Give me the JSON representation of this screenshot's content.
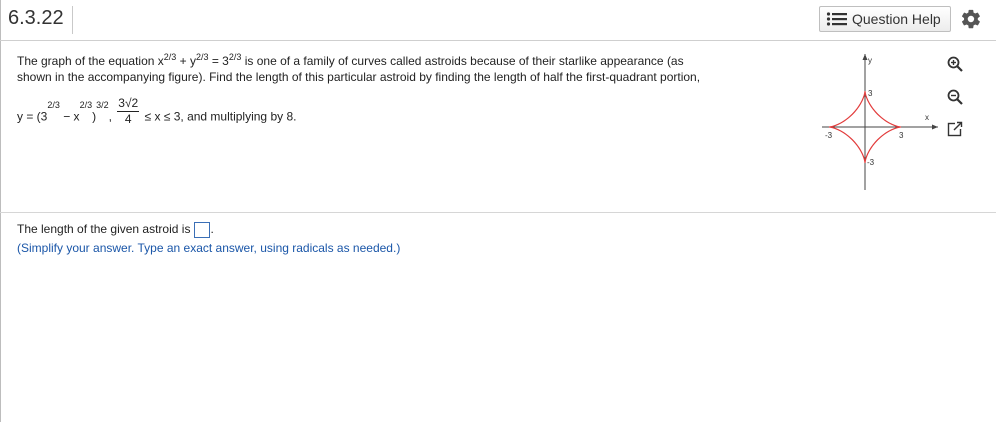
{
  "header": {
    "title": "6.3.22",
    "help_label": "Question Help"
  },
  "problem": {
    "line1_a": "The graph of the equation x",
    "line1_exp1": "2/3",
    "line1_b": "+ y",
    "line1_exp2": "2/3",
    "line1_c": "= 3",
    "line1_exp3": "2/3",
    "line1_d": "is one of a family of curves called astroids because of their starlike appearance (as",
    "line2": "shown in the accompanying figure). Find the length of this particular astroid by finding the length of half the first-quadrant portion,",
    "line3_a": "y = (3",
    "line3_exp1": "2/3",
    "line3_b": "− x",
    "line3_exp2": "2/3",
    "line3_c": ")",
    "line3_exp3": "3/2",
    "line3_frac_num": "3√2",
    "line3_frac_den": "4",
    "line3_d": "≤ x ≤ 3, and multiplying by 8."
  },
  "figure": {
    "x_label": "x",
    "y_label": "y",
    "tick_pos_x": "3",
    "tick_neg_x": "-3",
    "tick_pos_y": "3",
    "tick_neg_y": "-3",
    "curve_color": "#e23b3b"
  },
  "answer": {
    "prompt": "The length of the given astroid is",
    "note": "(Simplify your answer. Type an exact answer, using radicals as needed.)"
  }
}
